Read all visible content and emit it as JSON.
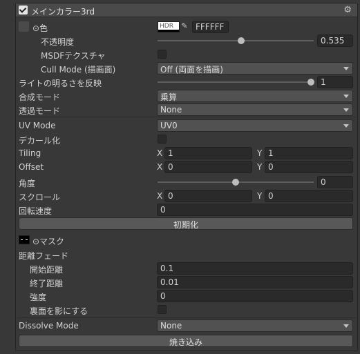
{
  "header": {
    "title": "メインカラー3rd",
    "enabled": true,
    "gear_icon": "gear-icon"
  },
  "color": {
    "label": "⊙色",
    "hdr_label": "HDR",
    "hex_value": "FFFFFF",
    "opacity_label": "不透明度",
    "opacity_value": "0.535",
    "opacity_fraction": 0.535,
    "msdf_label": "MSDFテクスチャ",
    "cull_label": "Cull Mode (描画面)",
    "cull_value": "Off (両面を描画)"
  },
  "lighting": {
    "label": "ライトの明るさを反映",
    "value": "1",
    "fraction": 1.0
  },
  "blend": {
    "label": "合成モード",
    "value": "乗算"
  },
  "transparent": {
    "label": "透過モード",
    "value": "None"
  },
  "uv": {
    "label": "UV Mode",
    "value": "UV0"
  },
  "decal": {
    "label": "デカール化"
  },
  "tiling": {
    "label": "Tiling",
    "x_label": "X",
    "x": "1",
    "y_label": "Y",
    "y": "1"
  },
  "offset": {
    "label": "Offset",
    "x_label": "X",
    "x": "0",
    "y_label": "Y",
    "y": "0"
  },
  "angle": {
    "label": "角度",
    "value": "0",
    "fraction": 0.5
  },
  "scroll": {
    "label": "スクロール",
    "x_label": "X",
    "x": "0",
    "y_label": "Y",
    "y": "0"
  },
  "rotation": {
    "label": "回転速度",
    "value": "0"
  },
  "reset_button": "初期化",
  "mask": {
    "label": "⊙マスク"
  },
  "distance_fade": {
    "label": "距離フェード",
    "start_label": "開始距離",
    "start_value": "0.1",
    "end_label": "終了距離",
    "end_value": "0.01",
    "strength_label": "強度",
    "strength_value": "0",
    "backface_label": "裏面を影にする"
  },
  "dissolve": {
    "label": "Dissolve Mode",
    "value": "None"
  },
  "bake_button": "焼き込み"
}
